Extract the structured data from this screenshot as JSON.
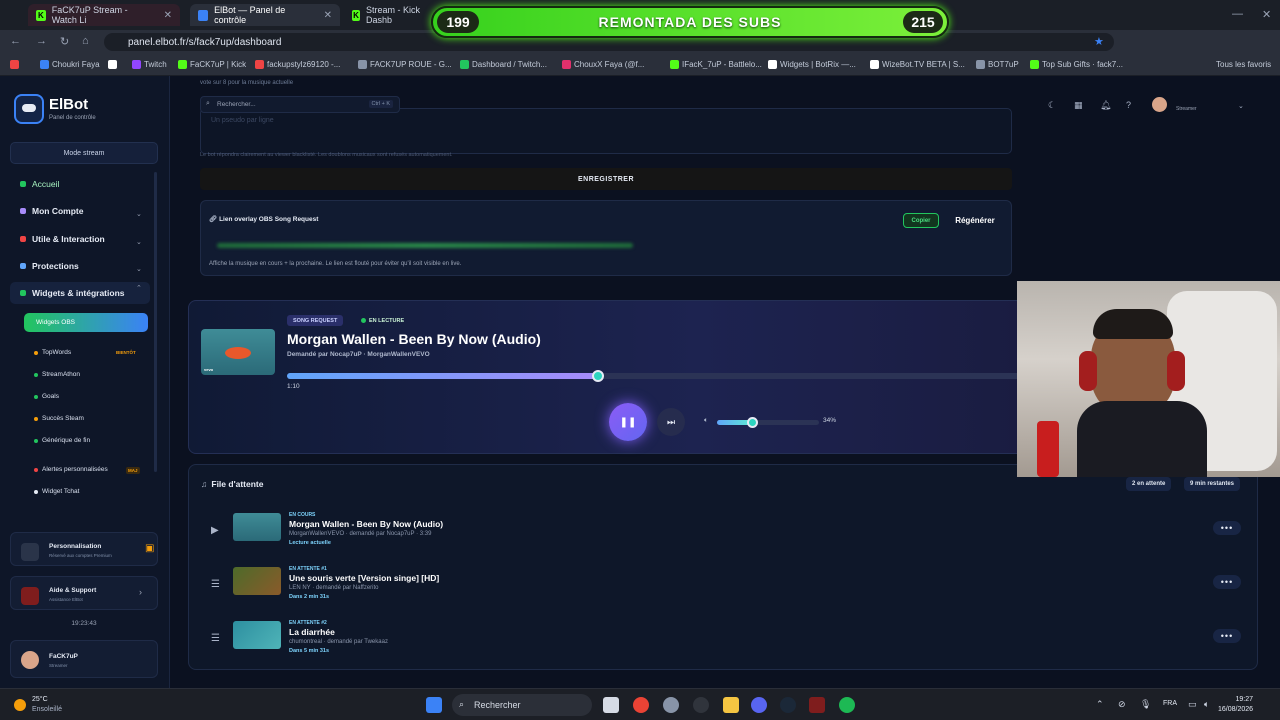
{
  "browser": {
    "tabs": [
      {
        "label": "FaCK7uP Stream - Watch Li",
        "active": false
      },
      {
        "label": "ElBot — Panel de contrôle",
        "active": true
      },
      {
        "label": "Stream - Kick Dashb",
        "active": false
      }
    ],
    "url": "panel.elbot.fr/s/fack7up/dashboard",
    "bookmarks": [
      "Choukri Faya",
      "Twitch",
      "FaCK7uP | Kick",
      "fackupstylz69120 -...",
      "FACK7UP ROUE - G...",
      "Dashboard / Twitch...",
      "ChouxX Faya (@f...",
      "IFacK_7uP - Battlelo...",
      "Widgets | BotRix —...",
      "WizeBot.TV BETA | S...",
      "BOT7uP",
      "Top Sub Gifts · fack7...",
      "Tous les favoris"
    ]
  },
  "overlay_banner": {
    "left": "199",
    "title": "REMONTADA DES SUBS",
    "right": "215"
  },
  "sidebar": {
    "brand": "ElBot",
    "brand_sub": "Panel de contrôle",
    "mode_stream": "Mode stream",
    "nav": [
      {
        "label": "Accueil",
        "color": "#22c55e"
      },
      {
        "label": "Mon Compte",
        "color": "#a78bfa"
      },
      {
        "label": "Utile & Interaction",
        "color": "#ef4444"
      },
      {
        "label": "Protections",
        "color": "#60a5fa"
      },
      {
        "label": "Widgets & intégrations",
        "color": "#22c55e"
      }
    ],
    "active_sub": "Widgets OBS",
    "subitems": [
      {
        "label": "TopWords",
        "tag": "BIENTÔT"
      },
      {
        "label": "StreamAthon",
        "tag": ""
      },
      {
        "label": "Goals",
        "tag": ""
      },
      {
        "label": "Succès Steam",
        "tag": ""
      },
      {
        "label": "Générique de fin",
        "tag": ""
      },
      {
        "label": "Alertes personnalisées",
        "tag": "MAJ"
      },
      {
        "label": "Widget Tchat",
        "tag": ""
      }
    ],
    "perso_title": "Personnalisation",
    "perso_sub": "Réservé aux comptes Premium",
    "help_title": "Aide & Support",
    "help_sub": "Assistance ElBot",
    "clock": "19:23:43",
    "user_name": "FaCK7uP",
    "user_role": "Streamer"
  },
  "topbar": {
    "search_placeholder": "Rechercher...",
    "search_shortcut": "Ctrl + K",
    "user_role": "Streamer"
  },
  "settings": {
    "vote_note": "vote sur 8 pour la musique actuelle",
    "textarea_placeholder": "Un pseudo par ligne",
    "bot_note": "Le bot répondra clairement au viewer blacklisté. Les doublons musicaux sont refusés automatiquement.",
    "save_label": "ENREGISTRER",
    "overlay_title": "Lien overlay OBS Song Request",
    "copy_label": "Copier",
    "regen_label": "Régénérer",
    "overlay_desc": "Affiche la musique en cours + la prochaine. Le lien est flouté pour éviter qu'il soit visible en live."
  },
  "player": {
    "badge": "SONG REQUEST",
    "status": "EN LECTURE",
    "title": "Morgan Wallen - Been By Now (Audio)",
    "requested": "Demandé par Nocap7uP · MorganWallenVEVO",
    "elapsed": "1:10",
    "progress": 0.42,
    "volume": 0.34,
    "volume_label": "34%"
  },
  "queue": {
    "title": "File d'attente",
    "waiting": "2 en attente",
    "remaining": "9 min restantes",
    "rows": [
      {
        "status": "EN COURS",
        "title": "Morgan Wallen - Been By Now (Audio)",
        "meta": "MorganWallenVEVO · demandé par Nocap7uP · 3:39",
        "eta": "Lecture actuelle"
      },
      {
        "status": "EN ATTENTE #1",
        "title": "Une souris verte [Version singe] [HD]",
        "meta": "LEN NY · demandé par Naffzerito",
        "eta": "Dans 2 min 31s"
      },
      {
        "status": "EN ATTENTE #2",
        "title": "La diarrhée",
        "meta": "chumontreal · demandé par Twekaaz",
        "eta": "Dans 5 min 31s"
      }
    ]
  },
  "taskbar": {
    "temp": "25°C",
    "weather": "Ensoleillé",
    "search": "Rechercher",
    "lang": "FRA",
    "time": "19:27",
    "date": "16/08/2026"
  }
}
